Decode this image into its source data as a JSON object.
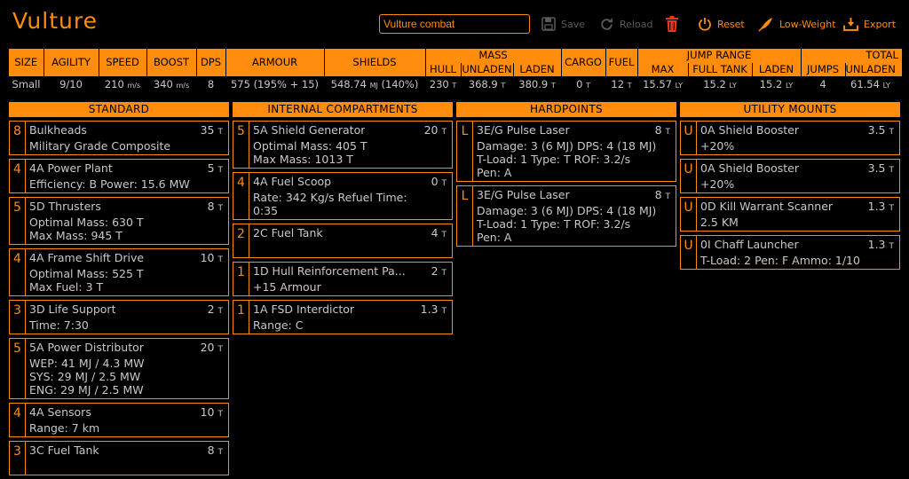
{
  "header": {
    "ship_name": "Vulture",
    "build_name": "Vulture combat",
    "save_label": "Save",
    "reload_label": "Reload",
    "reset_label": "Reset",
    "lowweight_label": "Low-Weight",
    "export_label": "Export"
  },
  "summary": {
    "headers": {
      "size": "SIZE",
      "agility": "AGILITY",
      "speed": "SPEED",
      "boost": "BOOST",
      "dps": "DPS",
      "armour": "ARMOUR",
      "shields": "SHIELDS",
      "mass": "MASS",
      "hull": "HULL",
      "unladen": "UNLADEN",
      "laden": "LADEN",
      "cargo": "CARGO",
      "fuel": "FUEL",
      "jump_range": "JUMP RANGE",
      "max": "MAX",
      "full_tank": "FULL TANK",
      "jr_laden": "LADEN",
      "total_range": "TOTAL RAN",
      "jumps": "JUMPS",
      "tr_unladen": "UNLADEN"
    },
    "values": {
      "size": "Small",
      "agility": "9/10",
      "speed": "210",
      "speed_unit": "m/s",
      "boost": "340",
      "boost_unit": "m/s",
      "dps": "8",
      "armour": "575 (195% + 15)",
      "shields": "548.74",
      "shields_unit": "MJ",
      "shields_extra": "(140%)",
      "hull": "230",
      "hull_unit": "T",
      "unladen": "368.9",
      "unladen_unit": "T",
      "laden": "380.9",
      "laden_unit": "T",
      "cargo": "0",
      "cargo_unit": "T",
      "fuel": "12",
      "fuel_unit": "T",
      "max": "15.57",
      "max_unit": "LY",
      "full_tank": "15.2",
      "full_tank_unit": "LY",
      "jr_laden": "15.2",
      "jr_laden_unit": "LY",
      "jumps": "4",
      "tr_unladen": "61.54",
      "tr_unladen_unit": "LY"
    }
  },
  "standard": {
    "title": "STANDARD",
    "slots": [
      {
        "cls": "8",
        "name": "Bulkheads",
        "mass": "35",
        "lines": [
          "Military Grade Composite"
        ]
      },
      {
        "cls": "4",
        "name": "4A Power Plant",
        "mass": "5",
        "lines": [
          "Efficiency: B   Power: 15.6 MW"
        ]
      },
      {
        "cls": "5",
        "name": "5D Thrusters",
        "mass": "8",
        "lines": [
          "Optimal Mass: 630 T",
          "Max Mass: 945 T"
        ]
      },
      {
        "cls": "4",
        "name": "4A Frame Shift Drive",
        "mass": "10",
        "lines": [
          "Optimal Mass: 525 T",
          "Max Fuel: 3 T"
        ]
      },
      {
        "cls": "3",
        "name": "3D Life Support",
        "mass": "2",
        "lines": [
          "Time: 7:30"
        ]
      },
      {
        "cls": "5",
        "name": "5A Power Distributor",
        "mass": "20",
        "lines": [
          "WEP: 41 MJ / 4.3 MW",
          "SYS: 29 MJ / 2.5 MW",
          "ENG: 29 MJ / 2.5 MW"
        ]
      },
      {
        "cls": "4",
        "name": "4A Sensors",
        "mass": "10",
        "lines": [
          "Range: 7 km"
        ]
      },
      {
        "cls": "3",
        "name": "3C Fuel Tank",
        "mass": "8",
        "lines": [
          ""
        ]
      }
    ]
  },
  "internal": {
    "title": "INTERNAL COMPARTMENTS",
    "slots": [
      {
        "cls": "5",
        "name": "5A Shield Generator",
        "mass": "20",
        "lines": [
          "Optimal Mass: 405 T",
          "Max Mass: 1013 T"
        ]
      },
      {
        "cls": "4",
        "name": "4A Fuel Scoop",
        "mass": "0",
        "lines": [
          "Rate: 342 Kg/s   Refuel Time:",
          "0:35"
        ]
      },
      {
        "cls": "2",
        "name": "2C Fuel Tank",
        "mass": "4",
        "lines": [
          ""
        ]
      },
      {
        "cls": "1",
        "name": "1D Hull Reinforcement Pa...",
        "mass": "2",
        "lines": [
          "+15 Armour"
        ]
      },
      {
        "cls": "1",
        "name": "1A FSD Interdictor",
        "mass": "1.3",
        "lines": [
          "Range: C"
        ]
      }
    ]
  },
  "hardpoints": {
    "title": "HARDPOINTS",
    "slots": [
      {
        "cls": "L",
        "name": "3E/G Pulse Laser",
        "mass": "8",
        "lines": [
          "Damage: 3 (6 MJ)   DPS: 4 (18 MJ)",
          "T-Load: 1   Type: T   ROF: 3.2/s",
          "Pen: A"
        ]
      },
      {
        "cls": "L",
        "name": "3E/G Pulse Laser",
        "mass": "8",
        "lines": [
          "Damage: 3 (6 MJ)   DPS: 4 (18 MJ)",
          "T-Load: 1   Type: T   ROF: 3.2/s",
          "Pen: A"
        ]
      }
    ]
  },
  "utility": {
    "title": "UTILITY MOUNTS",
    "slots": [
      {
        "cls": "U",
        "name": "0A Shield Booster",
        "mass": "3.5",
        "lines": [
          "+20%"
        ]
      },
      {
        "cls": "U",
        "name": "0A Shield Booster",
        "mass": "3.5",
        "lines": [
          "+20%"
        ]
      },
      {
        "cls": "U",
        "name": "0D Kill Warrant Scanner",
        "mass": "1.3",
        "lines": [
          "2.5 KM"
        ]
      },
      {
        "cls": "U",
        "name": "0I Chaff Launcher",
        "mass": "1.3",
        "lines": [
          "T-Load: 2   Pen: F   Ammo: 1/10"
        ]
      }
    ]
  },
  "mass_unit": "T",
  "colors": {
    "accent": "#ff8c0d",
    "text": "#c8c8c8",
    "background": "#000000",
    "disabled": "#5a5a5a"
  }
}
